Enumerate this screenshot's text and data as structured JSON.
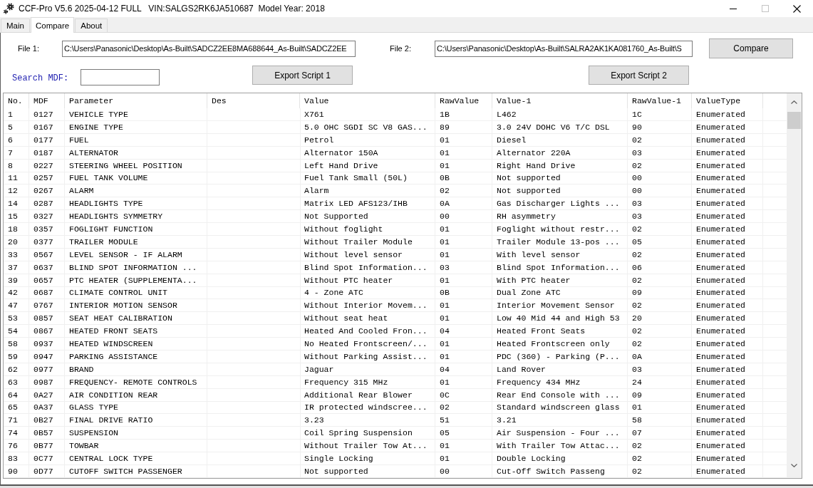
{
  "window": {
    "title": "CCF-Pro V5.6 2025-04-12 FULL   VIN:SALGS2RK6JA510687  Model Year: 2018",
    "maximize_disabled": true
  },
  "tabs": [
    {
      "label": "Main",
      "selected": false
    },
    {
      "label": "Compare",
      "selected": true
    },
    {
      "label": "About",
      "selected": false
    }
  ],
  "file_1": {
    "label": "File 1:",
    "value": "C:\\Users\\Panasonic\\Desktop\\As-Built\\SADCZ2EE8MA688644_As-Built\\SADCZ2EE"
  },
  "file_2": {
    "label": "File 2:",
    "value": "C:\\Users\\Panasonic\\Desktop\\As-Built\\SALRA2AK1KA081760_As-Built\\S"
  },
  "compare_button": "Compare",
  "search": {
    "label": "Search MDF:"
  },
  "export_buttons": [
    "Export Script 1",
    "Export Script 2"
  ],
  "table": {
    "columns": [
      "No.",
      "MDF",
      "Parameter",
      "Des",
      "Value",
      "RawValue",
      "Value-1",
      "RawValue-1",
      "ValueType"
    ],
    "rows": [
      {
        "no": "1",
        "mdf": "0127",
        "parameter": "VEHICLE TYPE",
        "value": "X761",
        "raw_value": "1B",
        "value_1": "L462",
        "raw_value_1": "1C",
        "value_type": "Enumerated"
      },
      {
        "no": "5",
        "mdf": "0167",
        "parameter": "ENGINE TYPE",
        "value": "5.0 OHC SGDI SC V8 GAS...",
        "raw_value": "89",
        "value_1": "3.0 24V DOHC V6 T/C DSL",
        "raw_value_1": "90",
        "value_type": "Enumerated"
      },
      {
        "no": "6",
        "mdf": "0177",
        "parameter": "FUEL",
        "value": "Petrol",
        "raw_value": "01",
        "value_1": "Diesel",
        "raw_value_1": "02",
        "value_type": "Enumerated"
      },
      {
        "no": "7",
        "mdf": "0187",
        "parameter": "ALTERNATOR",
        "value": "Alternator 150A",
        "raw_value": "01",
        "value_1": "Alternator 220A",
        "raw_value_1": "03",
        "value_type": "Enumerated"
      },
      {
        "no": "8",
        "mdf": "0227",
        "parameter": "STEERING WHEEL POSITION",
        "value": "Left Hand Drive",
        "raw_value": "01",
        "value_1": "Right Hand Drive",
        "raw_value_1": "02",
        "value_type": "Enumerated"
      },
      {
        "no": "11",
        "mdf": "0257",
        "parameter": "FUEL TANK VOLUME",
        "value": "Fuel Tank Small (50L)",
        "raw_value": "0B",
        "value_1": "Not supported",
        "raw_value_1": "00",
        "value_type": "Enumerated"
      },
      {
        "no": "12",
        "mdf": "0267",
        "parameter": "ALARM",
        "value": "Alarm",
        "raw_value": "02",
        "value_1": "Not supported",
        "raw_value_1": "00",
        "value_type": "Enumerated"
      },
      {
        "no": "14",
        "mdf": "0287",
        "parameter": "HEADLIGHTS TYPE",
        "value": "Matrix LED AFS123/IHB",
        "raw_value": "0A",
        "value_1": "Gas Discharger Lights ...",
        "raw_value_1": "03",
        "value_type": "Enumerated"
      },
      {
        "no": "15",
        "mdf": "0327",
        "parameter": "HEADLIGHTS SYMMETRY",
        "value": "Not Supported",
        "raw_value": "00",
        "value_1": "RH asymmetry",
        "raw_value_1": "03",
        "value_type": "Enumerated"
      },
      {
        "no": "18",
        "mdf": "0357",
        "parameter": "FOGLIGHT FUNCTION",
        "value": "Without foglight",
        "raw_value": "01",
        "value_1": "Foglight without restr...",
        "raw_value_1": "02",
        "value_type": "Enumerated"
      },
      {
        "no": "20",
        "mdf": "0377",
        "parameter": "TRAILER MODULE",
        "value": "Without Trailer Module",
        "raw_value": "01",
        "value_1": "Trailer Module 13-pos ...",
        "raw_value_1": "05",
        "value_type": "Enumerated"
      },
      {
        "no": "33",
        "mdf": "0567",
        "parameter": "LEVEL SENSOR - IF ALARM",
        "value": "Without level sensor",
        "raw_value": "01",
        "value_1": "With level sensor",
        "raw_value_1": "02",
        "value_type": "Enumerated"
      },
      {
        "no": "37",
        "mdf": "0637",
        "parameter": "BLIND SPOT INFORMATION ...",
        "value": "Blind Spot Information...",
        "raw_value": "03",
        "value_1": "Blind Spot Information...",
        "raw_value_1": "06",
        "value_type": "Enumerated"
      },
      {
        "no": "39",
        "mdf": "0657",
        "parameter": "PTC HEATER (SUPPLEMENTA...",
        "value": "Without PTC heater",
        "raw_value": "01",
        "value_1": "With PTC heater",
        "raw_value_1": "02",
        "value_type": "Enumerated"
      },
      {
        "no": "42",
        "mdf": "0687",
        "parameter": "CLIMATE CONTROL UNIT",
        "value": "4 - Zone ATC",
        "raw_value": "0B",
        "value_1": "Dual Zone ATC",
        "raw_value_1": "09",
        "value_type": "Enumerated"
      },
      {
        "no": "47",
        "mdf": "0767",
        "parameter": "INTERIOR MOTION SENSOR",
        "value": "Without Interior Movem...",
        "raw_value": "01",
        "value_1": "Interior Movement Sensor",
        "raw_value_1": "02",
        "value_type": "Enumerated"
      },
      {
        "no": "53",
        "mdf": "0857",
        "parameter": "SEAT HEAT CALIBRATION",
        "value": "Without seat heat",
        "raw_value": "01",
        "value_1": "Low 40 Mid 44 and High 53",
        "raw_value_1": "20",
        "value_type": "Enumerated"
      },
      {
        "no": "54",
        "mdf": "0867",
        "parameter": "HEATED FRONT SEATS",
        "value": "Heated And Cooled Fron...",
        "raw_value": "04",
        "value_1": "Heated Front Seats",
        "raw_value_1": "02",
        "value_type": "Enumerated"
      },
      {
        "no": "58",
        "mdf": "0937",
        "parameter": "HEATED WINDSCREEN",
        "value": "No Heated Frontscreen/...",
        "raw_value": "01",
        "value_1": "Heated Frontscreen only",
        "raw_value_1": "02",
        "value_type": "Enumerated"
      },
      {
        "no": "59",
        "mdf": "0947",
        "parameter": "PARKING ASSISTANCE",
        "value": "Without Parking Assist...",
        "raw_value": "01",
        "value_1": "PDC (360) - Parking (P...",
        "raw_value_1": "0A",
        "value_type": "Enumerated"
      },
      {
        "no": "62",
        "mdf": "0977",
        "parameter": "BRAND",
        "value": "Jaguar",
        "raw_value": "04",
        "value_1": "Land Rover",
        "raw_value_1": "03",
        "value_type": "Enumerated"
      },
      {
        "no": "63",
        "mdf": "0987",
        "parameter": "FREQUENCY- REMOTE CONTROLS",
        "value": "Frequency 315 MHz",
        "raw_value": "01",
        "value_1": "Frequency 434 MHz",
        "raw_value_1": "24",
        "value_type": "Enumerated"
      },
      {
        "no": "64",
        "mdf": "0A27",
        "parameter": "AIR CONDITION REAR",
        "value": "Additional Rear Blower",
        "raw_value": "0C",
        "value_1": "Rear End Console with ...",
        "raw_value_1": "09",
        "value_type": "Enumerated"
      },
      {
        "no": "65",
        "mdf": "0A37",
        "parameter": "GLASS TYPE",
        "value": "IR protected windscree...",
        "raw_value": "02",
        "value_1": "Standard windscreen glass",
        "raw_value_1": "01",
        "value_type": "Enumerated"
      },
      {
        "no": "71",
        "mdf": "0B27",
        "parameter": "FINAL DRIVE RATIO",
        "value": "3.23",
        "raw_value": "51",
        "value_1": "3.21",
        "raw_value_1": "58",
        "value_type": "Enumerated"
      },
      {
        "no": "74",
        "mdf": "0B57",
        "parameter": "SUSPENSION",
        "value": "Coil Spring Suspension",
        "raw_value": "05",
        "value_1": "Air Suspension - Four ...",
        "raw_value_1": "07",
        "value_type": "Enumerated"
      },
      {
        "no": "76",
        "mdf": "0B77",
        "parameter": "TOWBAR",
        "value": "Without Trailer Tow At...",
        "raw_value": "01",
        "value_1": "With Trailer Tow Attac...",
        "raw_value_1": "02",
        "value_type": "Enumerated"
      },
      {
        "no": "83",
        "mdf": "0C77",
        "parameter": "CENTRAL LOCK TYPE",
        "value": "Single Locking",
        "raw_value": "01",
        "value_1": "Double Locking",
        "raw_value_1": "02",
        "value_type": "Enumerated"
      },
      {
        "no": "90",
        "mdf": "0D77",
        "parameter": "CUTOFF SWITCH PASSENGER",
        "value": "Not supported",
        "raw_value": "00",
        "value_1": "Cut-Off Switch Passeng",
        "raw_value_1": "02",
        "value_type": "Enumerated"
      }
    ]
  }
}
